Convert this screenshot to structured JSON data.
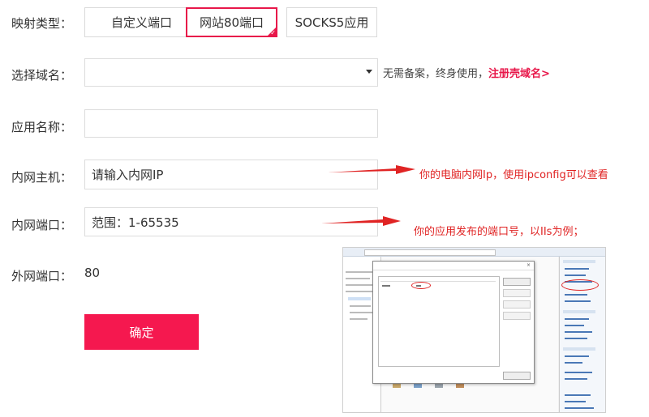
{
  "mapping": {
    "label": "映射类型：",
    "tabs": [
      {
        "label": "自定义端口",
        "active": false
      },
      {
        "label": "网站80端口",
        "active": true
      },
      {
        "label": "SOCKS5应用",
        "active": false
      }
    ]
  },
  "domain": {
    "label": "选择域名：",
    "value": "",
    "hint": "无需备案，终身使用，",
    "link": "注册壳域名>"
  },
  "app_name": {
    "label": "应用名称：",
    "value": ""
  },
  "host": {
    "label": "内网主机：",
    "placeholder": "请输入内网IP",
    "annotation": "你的电脑内网Ip，使用ipconfig可以查看"
  },
  "port": {
    "label": "内网端口：",
    "placeholder": "范围：1-65535",
    "annotation": "你的应用发布的端口号，以IIs为例；"
  },
  "external_port": {
    "label": "外网端口：",
    "value": "80"
  },
  "confirm_label": "确定",
  "colors": {
    "accent": "#e8174a",
    "annotation": "#e02424"
  }
}
